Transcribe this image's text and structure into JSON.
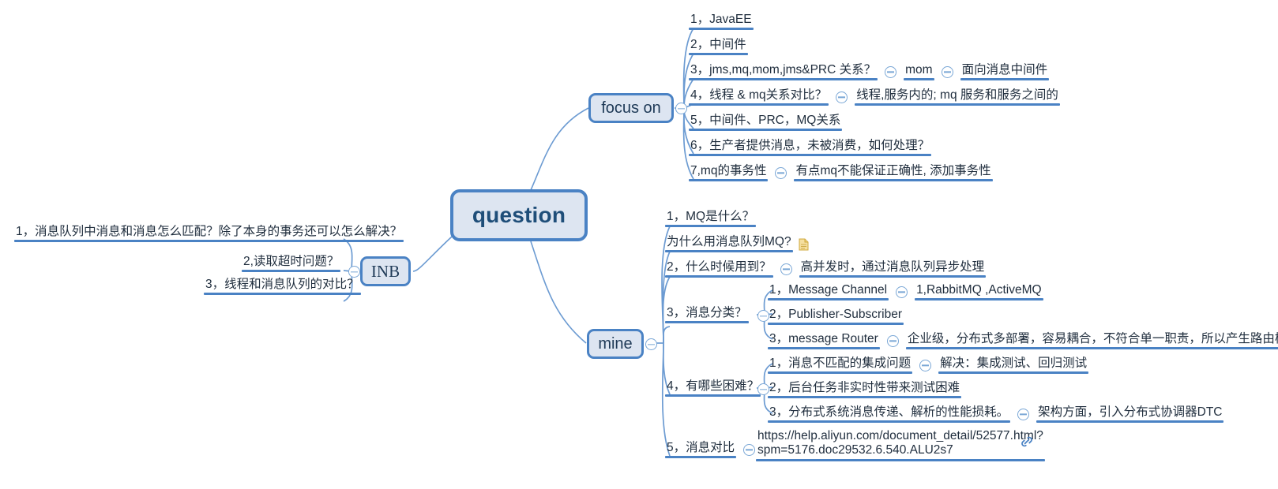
{
  "root": {
    "label": "question"
  },
  "branches": [
    {
      "id": "focus-on",
      "label": "focus on",
      "side": "right",
      "items": [
        {
          "text": "1，JavaEE"
        },
        {
          "text": "2，中间件"
        },
        {
          "text": "3，jms,mq,mom,jms&PRC 关系？",
          "children": [
            {
              "text": "mom",
              "children": [
                {
                  "text": "面向消息中间件"
                }
              ]
            }
          ]
        },
        {
          "text": "4，线程 & mq关系对比？",
          "children": [
            {
              "text": "线程,服务内的; mq 服务和服务之间的"
            }
          ]
        },
        {
          "text": "5，中间件、PRC，MQ关系"
        },
        {
          "text": "6，生产者提供消息，未被消费，如何处理？"
        },
        {
          "text": "7,mq的事务性",
          "children": [
            {
              "text": "有点mq不能保证正确性, 添加事务性"
            }
          ]
        }
      ]
    },
    {
      "id": "mine",
      "label": "mine",
      "side": "right",
      "items": [
        {
          "text": "1，MQ是什么？"
        },
        {
          "text": "为什么用消息队列MQ?",
          "icon": "document-icon"
        },
        {
          "text": "2，什么时候用到？",
          "children": [
            {
              "text": "高并发时，通过消息队列异步处理"
            }
          ]
        },
        {
          "text": "3，消息分类？",
          "children": [
            {
              "text": "1，Message Channel",
              "children": [
                {
                  "text": "1,RabbitMQ ,ActiveMQ"
                }
              ]
            },
            {
              "text": "2，Publisher-Subscriber"
            },
            {
              "text": "3，message Router",
              "children": [
                {
                  "text": "企业级，分布式多部署，容易耦合，不符合单一职责，所以产生路由模式"
                }
              ]
            }
          ]
        },
        {
          "text": "4，有哪些困难？",
          "children": [
            {
              "text": "1，消息不匹配的集成问题",
              "children": [
                {
                  "text": "解决：集成测试、回归测试"
                }
              ]
            },
            {
              "text": "2，后台任务非实时性带来测试困难"
            },
            {
              "text": "3，分布式系统消息传递、解析的性能损耗。",
              "children": [
                {
                  "text": "架构方面，引入分布式协调器DTC"
                }
              ]
            }
          ]
        },
        {
          "text": "5，消息对比",
          "children": [
            {
              "text_line1": "https://help.aliyun.com/document_detail/52577.html?",
              "text_line2": "spm=5176.doc29532.6.540.ALU2s7",
              "icon": "link-icon"
            }
          ]
        }
      ]
    },
    {
      "id": "inb",
      "label": "INB",
      "side": "left",
      "items": [
        {
          "text": "1，消息队列中消息和消息怎么匹配？除了本身的事务还可以怎么解决？"
        },
        {
          "text": "2,读取超时问题？"
        },
        {
          "text": "3，线程和消息队列的对比？"
        }
      ]
    }
  ],
  "colors": {
    "branch_line": "#4a82c4",
    "node_fill": "#dde5f1",
    "node_border": "#4a82c4",
    "root_text": "#1f4e79",
    "text": "#1f2d3d",
    "toggle": "#7aa7d6",
    "doc_icon": "#e8c468",
    "link_icon": "#4a82c4",
    "background": "#ffffff"
  }
}
